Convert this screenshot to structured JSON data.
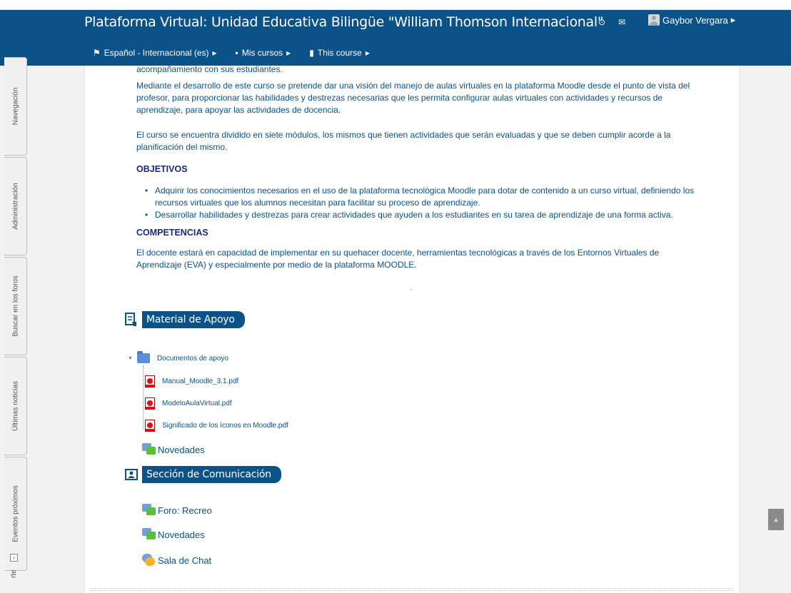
{
  "header": {
    "title": "Plataforma Virtual: Unidad Educativa Bilingüe \"William Thomson Internacional\"",
    "user_name": "Gaybor Vergara",
    "nav": [
      {
        "label": "Español - Internacional (es)",
        "icon": "flag-icon"
      },
      {
        "label": "Mis cursos",
        "icon": "briefcase-icon"
      },
      {
        "label": "This course",
        "icon": "book-icon"
      }
    ],
    "icons": [
      "target-icon",
      "message-icon"
    ]
  },
  "dock": {
    "tabs": [
      "Navegación",
      "Administración",
      "Buscar en los foros",
      "Últimas noticias",
      "Eventos próximos"
    ],
    "cut_tab": "rte"
  },
  "course": {
    "intro_cut": "acompañamiento con sus estudiantes.",
    "paragraph1": "Mediante el desarrollo de este curso se pretende dar una visión del manejo de aulas virtuales en la plataforma Moodle desde el punto de vista del profesor, para proporcionar las habilidades y destrezas necesarias que les permita configurar aulas virtuales con actividades y recursos de aprendizaje, para apoyar las actividades de docencia.",
    "paragraph2": "El curso se encuentra dividido en siete módulos, los mismos que tienen actividades que serán evaluadas y que se deben cumplir acorde a la planificación del mismo.",
    "objetivos_heading": "OBJETIVOS",
    "objetivos": [
      "Adquirir los conocimientos necesarios en el uso de la plataforma tecnológica Moodle para dotar de contenido a un curso virtual, definiendo los recursos virtuales que los alumnos necesitan para facilitar su proceso de aprendizaje.",
      "Desarrollar habilidades y destrezas para crear actividades que ayuden a los estudiantes en su tarea de aprendizaje de una forma activa."
    ],
    "competencias_heading": "COMPETENCIAS",
    "competencias": "El docente estará en capacidad de implementar en su quehacer docente, herramientas tecnológicas a través de los Entornos Virtuales de Aprendizaje (EVA) y especialmente por medio de la plataforma MOODLE.",
    "separator": "-"
  },
  "material": {
    "title": "Material de Apoyo",
    "folder": "Documentos de apoyo",
    "files": [
      "Manual_Moodle_3.1.pdf",
      "ModeloAulaVirtual.pdf",
      "Significado de los íconos en Moodle.pdf"
    ],
    "news": "Novedades"
  },
  "comunicacion": {
    "title": "Sección de Comunicación",
    "activities": [
      "Foro: Recreo",
      "Novedades",
      "Sala de Chat"
    ]
  },
  "colors": {
    "brand": "#0b5288",
    "heading": "#1a2a78"
  }
}
